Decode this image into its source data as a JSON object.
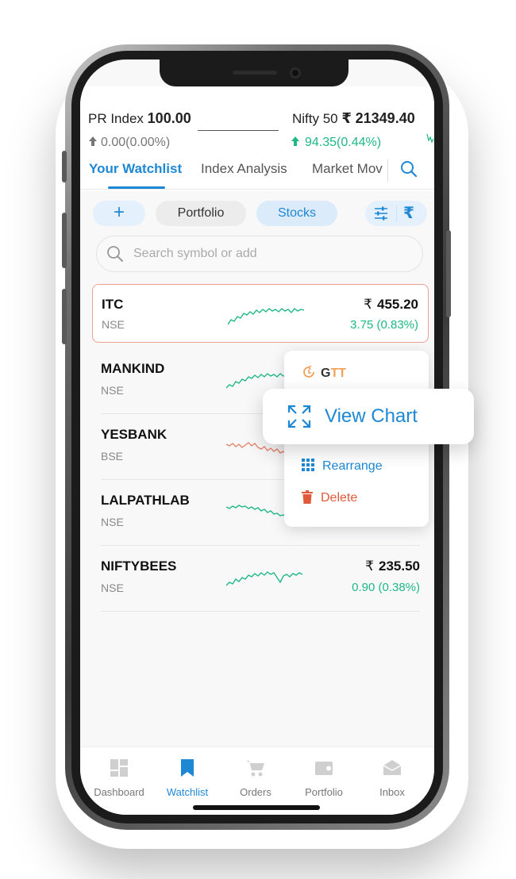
{
  "header": {
    "pr_index": {
      "label": "PR Index",
      "value": "100.00",
      "change": "0.00(0.00%)"
    },
    "nifty": {
      "label": "Nifty 50",
      "currency": "₹",
      "value": "21349.40",
      "change": "94.35(0.44%)"
    }
  },
  "tabs": [
    {
      "label": "Your Watchlist"
    },
    {
      "label": "Index Analysis"
    },
    {
      "label": "Market Mov"
    }
  ],
  "filters": {
    "add_label": "+",
    "portfolio_label": "Portfolio",
    "stocks_label": "Stocks",
    "rupee_label": "₹"
  },
  "search": {
    "placeholder": "Search symbol or add"
  },
  "watchlist": [
    {
      "symbol": "ITC",
      "exchange": "NSE",
      "currency": "₹",
      "price": "455.20",
      "change": "3.75 (0.83%)",
      "trend": "up"
    },
    {
      "symbol": "MANKIND",
      "exchange": "NSE",
      "trend": "up"
    },
    {
      "symbol": "YESBANK",
      "exchange": "BSE",
      "trend": "down"
    },
    {
      "symbol": "LALPATHLAB",
      "exchange": "NSE",
      "trend": "up"
    },
    {
      "symbol": "NIFTYBEES",
      "exchange": "NSE",
      "currency": "₹",
      "price": "235.50",
      "change": "0.90 (0.38%)",
      "trend": "up"
    }
  ],
  "context_menu": {
    "gtt_g": "G",
    "gtt_tt": "TT",
    "view_chart": "View Chart",
    "rearrange": "Rearrange",
    "delete": "Delete"
  },
  "bottom_nav": [
    {
      "label": "Dashboard"
    },
    {
      "label": "Watchlist"
    },
    {
      "label": "Orders"
    },
    {
      "label": "Portfolio"
    },
    {
      "label": "Inbox"
    }
  ],
  "colors": {
    "accent": "#1e88d4",
    "positive": "#1eb886",
    "negative": "#e8846a",
    "danger": "#e05a3a",
    "gtt": "#f0a25a"
  }
}
